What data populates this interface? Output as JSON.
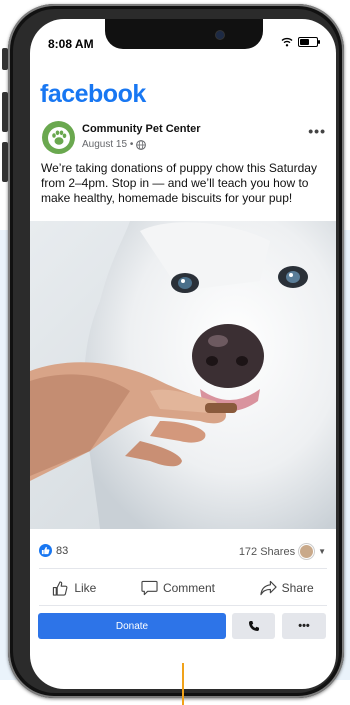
{
  "status_bar": {
    "time": "8:08 AM"
  },
  "app": {
    "logo_text": "facebook",
    "brand_color": "#1877f2"
  },
  "post": {
    "page_name": "Community Pet Center",
    "date": "August 15 •",
    "audience_icon": "globe-icon",
    "text": "We’re taking donations of puppy chow this Saturday from 2–4pm. Stop in — and we’ll teach you how to make healthy, homemade biscuits for your pup!",
    "photo": "white-dog-being-fed-by-hand"
  },
  "engagement": {
    "reactions_count": "83",
    "shares": "172 Shares"
  },
  "actions": {
    "like": "Like",
    "comment": "Comment",
    "share": "Share"
  },
  "buttons": {
    "donate": "Donate",
    "call_icon": "phone-icon",
    "more": "•••"
  },
  "colors": {
    "donate_bg": "#2d74e8",
    "avatar_bg": "#6aa84f"
  }
}
